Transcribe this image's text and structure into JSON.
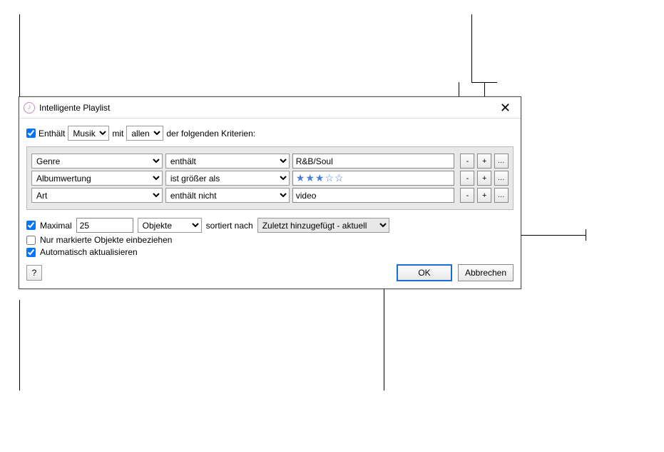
{
  "title": "Intelligente Playlist",
  "match": {
    "checkbox_label": "Enthält",
    "checked": true,
    "media_type": "Musik",
    "joiner": "mit",
    "mode": "allen",
    "suffix": "der folgenden Kriterien:"
  },
  "rules": [
    {
      "field": "Genre",
      "operator": "enthält",
      "value_type": "text",
      "value": "R&B/Soul"
    },
    {
      "field": "Albumwertung",
      "operator": "ist größer als",
      "value_type": "stars",
      "stars": 3,
      "stars_max": 5
    },
    {
      "field": "Art",
      "operator": "enthält nicht",
      "value_type": "text",
      "value": "video"
    }
  ],
  "rule_buttons": {
    "remove": "-",
    "add": "+",
    "more": "…"
  },
  "limit": {
    "label": "Maximal",
    "checked": true,
    "value": "25",
    "units": "Objekte",
    "sort_label": "sortiert nach",
    "sort_value": "Zuletzt hinzugefügt - aktuell"
  },
  "only_checked": {
    "label": "Nur markierte Objekte einbeziehen",
    "checked": false
  },
  "live_update": {
    "label": "Automatisch aktualisieren",
    "checked": true
  },
  "buttons": {
    "help": "?",
    "ok": "OK",
    "cancel": "Abbrechen"
  }
}
